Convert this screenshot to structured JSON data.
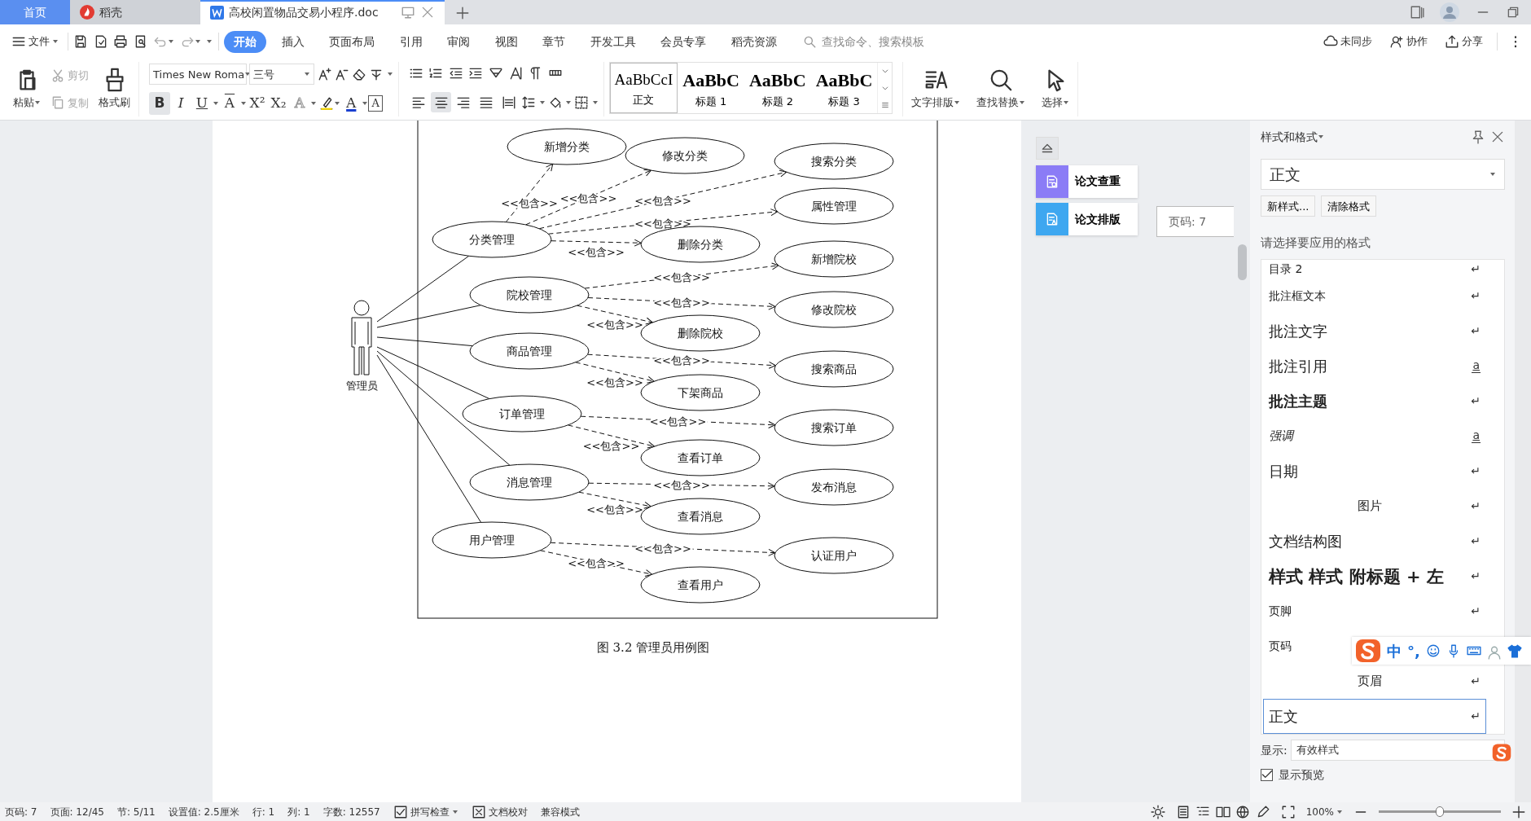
{
  "tabs": [
    {
      "label": "首页",
      "kind": "home",
      "selected": false
    },
    {
      "label": "稻壳",
      "kind": "docer",
      "selected": false
    },
    {
      "label": "高校闲置物品交易小程序.doc",
      "kind": "document",
      "selected": true
    }
  ],
  "menu": {
    "file": "文件",
    "tabs": [
      {
        "label": "开始",
        "selected": true
      },
      {
        "label": "插入",
        "selected": false
      },
      {
        "label": "页面布局",
        "selected": false
      },
      {
        "label": "引用",
        "selected": false
      },
      {
        "label": "审阅",
        "selected": false
      },
      {
        "label": "视图",
        "selected": false
      },
      {
        "label": "章节",
        "selected": false
      },
      {
        "label": "开发工具",
        "selected": false
      },
      {
        "label": "会员专享",
        "selected": false
      },
      {
        "label": "稻壳资源",
        "selected": false
      }
    ],
    "search": {
      "placeholder": "查找命令、搜索模板"
    },
    "actions": [
      {
        "label": "未同步",
        "kind": "sync"
      },
      {
        "label": "协作",
        "kind": "collab"
      },
      {
        "label": "分享",
        "kind": "share"
      }
    ]
  },
  "ribbon": {
    "paste": "粘贴",
    "cut": {
      "label": "剪切",
      "disabled": true
    },
    "copy": {
      "label": "复制",
      "disabled": true
    },
    "painter": "格式刷",
    "font": {
      "name": "Times New Roma",
      "size": "三号"
    },
    "format_buttons": [
      {
        "label": "B",
        "kind": "bold",
        "selected": true
      },
      {
        "label": "I",
        "kind": "italic",
        "selected": false
      },
      {
        "label": "U",
        "kind": "underline",
        "selected": false
      },
      {
        "label": "A",
        "kind": "strike",
        "selected": false
      },
      {
        "label": "X²",
        "kind": "super",
        "selected": false
      },
      {
        "label": "X₂",
        "kind": "sub",
        "selected": false
      },
      {
        "label": "A",
        "kind": "effect",
        "selected": false
      },
      {
        "label": "A",
        "kind": "color",
        "selected": false
      },
      {
        "label": "A",
        "kind": "border",
        "selected": false
      }
    ],
    "align_buttons": [
      {
        "kind": "left",
        "selected": false
      },
      {
        "kind": "center",
        "selected": true
      },
      {
        "kind": "right",
        "selected": false
      },
      {
        "kind": "justify",
        "selected": false
      },
      {
        "kind": "distribute",
        "selected": false
      }
    ],
    "styles": [
      {
        "preview": "AaBbCcI",
        "label": "正文",
        "kind": "body",
        "selected": true
      },
      {
        "preview": "AaBbC",
        "label": "标题 1",
        "kind": "heading",
        "selected": false
      },
      {
        "preview": "AaBbC",
        "label": "标题 2",
        "kind": "heading",
        "selected": false
      },
      {
        "preview": "AaBbC",
        "label": "标题 3",
        "kind": "heading",
        "selected": false
      }
    ],
    "big_buttons": [
      {
        "label": "文字排版",
        "kind": "layout"
      },
      {
        "label": "查找替换",
        "kind": "find"
      },
      {
        "label": "选择",
        "kind": "select"
      }
    ]
  },
  "diagram": {
    "actor": "管理员",
    "caption": "图 3.2  管理员用例图",
    "managers": [
      {
        "label": "分类管理",
        "includes": [
          {
            "label": "新增分类",
            "relation": "<<包含>>"
          },
          {
            "label": "修改分类",
            "relation": "<<包含>>"
          },
          {
            "label": "搜索分类",
            "relation": "<<包含>>"
          },
          {
            "label": "属性管理",
            "relation": "<<包含>>"
          },
          {
            "label": "删除分类",
            "relation": "<<包含>>"
          }
        ]
      },
      {
        "label": "院校管理",
        "includes": [
          {
            "label": "新增院校",
            "relation": "<<包含>>"
          },
          {
            "label": "修改院校",
            "relation": "<<包含>>"
          },
          {
            "label": "删除院校",
            "relation": "<<包含>>"
          }
        ]
      },
      {
        "label": "商品管理",
        "includes": [
          {
            "label": "搜索商品",
            "relation": "<<包含>>"
          },
          {
            "label": "下架商品",
            "relation": "<<包含>>"
          }
        ]
      },
      {
        "label": "订单管理",
        "includes": [
          {
            "label": "搜索订单",
            "relation": "<<包含>>"
          },
          {
            "label": "查看订单",
            "relation": "<<包含>>"
          }
        ]
      },
      {
        "label": "消息管理",
        "includes": [
          {
            "label": "发布消息",
            "relation": "<<包含>>"
          },
          {
            "label": "查看消息",
            "relation": "<<包含>>"
          }
        ]
      },
      {
        "label": "用户管理",
        "includes": [
          {
            "label": "认证用户",
            "relation": "<<包含>>"
          },
          {
            "label": "查看用户",
            "relation": "<<包含>>"
          }
        ]
      }
    ]
  },
  "side_tools": [
    {
      "label": "论文查重",
      "color": "#8b7cf6"
    },
    {
      "label": "论文排版",
      "color": "#3ea7f0"
    }
  ],
  "page_tooltip": "页码: 7",
  "styles_panel": {
    "title": "样式和格式",
    "current": "正文",
    "buttons": [
      "新样式...",
      "清除格式"
    ],
    "prompt": "请选择要应用的格式",
    "items": [
      {
        "label": "目录 2",
        "kind": "plain",
        "mark": "↵",
        "character": false,
        "selected": false
      },
      {
        "label": "批注框文本",
        "kind": "plain",
        "mark": "↵",
        "character": false,
        "selected": false
      },
      {
        "label": "批注文字",
        "kind": "serif",
        "mark": "↵",
        "character": false,
        "selected": false
      },
      {
        "label": "批注引用",
        "kind": "serif",
        "mark": "a",
        "character": true,
        "selected": false
      },
      {
        "label": "批注主题",
        "kind": "bold",
        "mark": "↵",
        "character": false,
        "selected": false
      },
      {
        "label": "强调",
        "kind": "italic",
        "mark": "a",
        "character": true,
        "selected": false
      },
      {
        "label": "日期",
        "kind": "serif",
        "mark": "↵",
        "character": false,
        "selected": false
      },
      {
        "label": "图片",
        "kind": "centered",
        "mark": "↵",
        "character": false,
        "selected": false
      },
      {
        "label": "文档结构图",
        "kind": "serif",
        "mark": "↵",
        "character": false,
        "selected": false
      },
      {
        "label": "样式 样式 附标题 + 左",
        "kind": "heading",
        "mark": "↵",
        "character": false,
        "selected": false
      },
      {
        "label": "页脚",
        "kind": "plain",
        "mark": "↵",
        "character": false,
        "selected": false
      },
      {
        "label": "页码",
        "kind": "plain",
        "selected": false
      },
      {
        "label": "页眉",
        "kind": "centered",
        "mark": "↵",
        "character": false,
        "selected": false
      },
      {
        "label": "正文",
        "kind": "serif",
        "mark": "↵",
        "character": false,
        "selected": true
      }
    ],
    "show_label": "显示:",
    "show_value": "有效样式",
    "preview": {
      "label": "显示预览",
      "checked": true
    }
  },
  "ime": {
    "mode": "中",
    "punct": "°,"
  },
  "status": {
    "items": [
      "页码: 7",
      "页面: 12/45",
      "节: 5/11",
      "设置值: 2.5厘米",
      "行: 1",
      "列: 1",
      "字数: 12557"
    ],
    "checks": [
      {
        "label": "拼写检查",
        "kind": "spell"
      },
      {
        "label": "文档校对",
        "kind": "proof"
      }
    ],
    "mode": "兼容模式",
    "zoom": {
      "label": "100%",
      "level": 0.5
    }
  }
}
